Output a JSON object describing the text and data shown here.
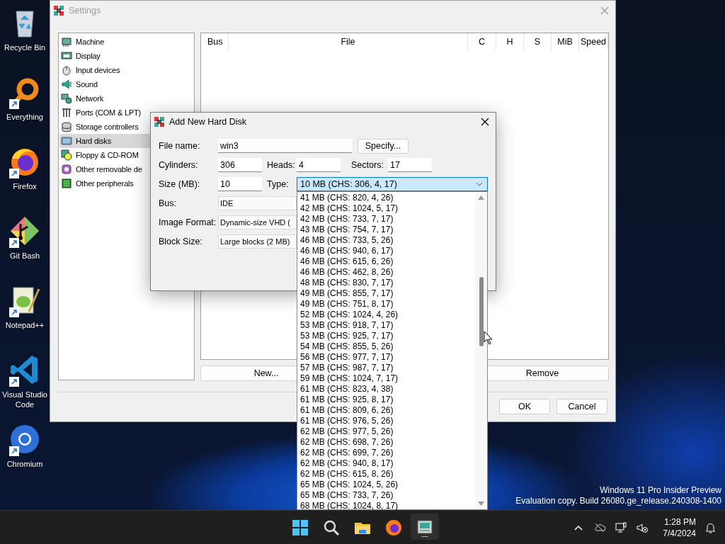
{
  "desktop_icons": [
    {
      "label": "Recycle Bin",
      "kind": "recycle",
      "shortcut": false
    },
    {
      "label": "Everything",
      "kind": "everything",
      "shortcut": true
    },
    {
      "label": "Firefox",
      "kind": "firefox",
      "shortcut": true
    },
    {
      "label": "Git Bash",
      "kind": "git",
      "shortcut": true
    },
    {
      "label": "Notepad++",
      "kind": "notepad",
      "shortcut": true
    },
    {
      "label": "Visual Studio Code",
      "kind": "vscode",
      "shortcut": true
    },
    {
      "label": "Chromium",
      "kind": "chromium",
      "shortcut": true
    }
  ],
  "settings": {
    "title": "Settings",
    "sidebar": [
      {
        "label": "Machine",
        "kind": "machine",
        "selected": false
      },
      {
        "label": "Display",
        "kind": "display",
        "selected": false
      },
      {
        "label": "Input devices",
        "kind": "input",
        "selected": false
      },
      {
        "label": "Sound",
        "kind": "sound",
        "selected": false
      },
      {
        "label": "Network",
        "kind": "network",
        "selected": false
      },
      {
        "label": "Ports (COM & LPT)",
        "kind": "ports",
        "selected": false
      },
      {
        "label": "Storage controllers",
        "kind": "storage",
        "selected": false
      },
      {
        "label": "Hard disks",
        "kind": "harddisk",
        "selected": true
      },
      {
        "label": "Floppy & CD-ROM",
        "kind": "floppy",
        "selected": false
      },
      {
        "label": "Other removable de",
        "kind": "removable",
        "selected": false
      },
      {
        "label": "Other peripherals",
        "kind": "peripherals",
        "selected": false
      }
    ],
    "table": {
      "columns": [
        "Bus",
        "File",
        "C",
        "H",
        "S",
        "MiB",
        "Speed"
      ]
    },
    "new_button": "New...",
    "remove_button": "Remove",
    "ok_button": "OK",
    "cancel_button": "Cancel"
  },
  "dialog": {
    "title": "Add New Hard Disk",
    "file_name": {
      "label": "File name:",
      "value": "win3"
    },
    "specify_button": "Specify...",
    "cylinders": {
      "label": "Cylinders:",
      "value": "306"
    },
    "heads": {
      "label": "Heads:",
      "value": "4"
    },
    "sectors": {
      "label": "Sectors:",
      "value": "17"
    },
    "size": {
      "label": "Size (MB):",
      "value": "10"
    },
    "type": {
      "label": "Type:",
      "value": "10 MB (CHS: 306, 4, 17)",
      "expanded": true,
      "options": [
        {
          "label": "41 MB (CHS: 820, 4, 26)",
          "selected": false
        },
        {
          "label": "42 MB (CHS: 1024, 5, 17)",
          "selected": false
        },
        {
          "label": "42 MB (CHS: 733, 7, 17)",
          "selected": false
        },
        {
          "label": "43 MB (CHS: 754, 7, 17)",
          "selected": false
        },
        {
          "label": "46 MB (CHS: 733, 5, 26)",
          "selected": false
        },
        {
          "label": "46 MB (CHS: 940, 6, 17)",
          "selected": false
        },
        {
          "label": "46 MB (CHS: 615, 6, 26)",
          "selected": false
        },
        {
          "label": "46 MB (CHS: 462, 8, 26)",
          "selected": false
        },
        {
          "label": "48 MB (CHS: 830, 7, 17)",
          "selected": false
        },
        {
          "label": "49 MB (CHS: 855, 7, 17)",
          "selected": false
        },
        {
          "label": "49 MB (CHS: 751, 8, 17)",
          "selected": false
        },
        {
          "label": "52 MB (CHS: 1024, 4, 26)",
          "selected": false
        },
        {
          "label": "53 MB (CHS: 918, 7, 17)",
          "selected": false
        },
        {
          "label": "53 MB (CHS: 925, 7, 17)",
          "selected": false
        },
        {
          "label": "54 MB (CHS: 855, 5, 26)",
          "selected": false
        },
        {
          "label": "56 MB (CHS: 977, 7, 17)",
          "selected": false
        },
        {
          "label": "57 MB (CHS: 987, 7, 17)",
          "selected": false
        },
        {
          "label": "59 MB (CHS: 1024, 7, 17)",
          "selected": false
        },
        {
          "label": "61 MB (CHS: 823, 4, 38)",
          "selected": false
        },
        {
          "label": "61 MB (CHS: 925, 8, 17)",
          "selected": false
        },
        {
          "label": "61 MB (CHS: 809, 6, 26)",
          "selected": false
        },
        {
          "label": "61 MB (CHS: 976, 5, 26)",
          "selected": false
        },
        {
          "label": "62 MB (CHS: 977, 5, 26)",
          "selected": false
        },
        {
          "label": "62 MB (CHS: 698, 7, 26)",
          "selected": false
        },
        {
          "label": "62 MB (CHS: 699, 7, 26)",
          "selected": false
        },
        {
          "label": "62 MB (CHS: 940, 8, 17)",
          "selected": false
        },
        {
          "label": "62 MB (CHS: 615, 8, 26)",
          "selected": false
        },
        {
          "label": "65 MB (CHS: 1024, 5, 26)",
          "selected": false
        },
        {
          "label": "65 MB (CHS: 733, 7, 26)",
          "selected": false
        },
        {
          "label": "68 MB (CHS: 1024, 8, 17)",
          "selected": false
        }
      ]
    },
    "bus": {
      "label": "Bus:",
      "value": "IDE"
    },
    "image_format": {
      "label": "Image Format:",
      "value": "Dynamic-size VHD ("
    },
    "block_size": {
      "label": "Block Size:",
      "value": "Large blocks (2 MB)"
    }
  },
  "os_notice": [
    "Windows 11 Pro Insider Preview",
    "Evaluation copy. Build 26080.ge_release.240308-1400"
  ],
  "taskbar": {
    "apps": [
      {
        "kind": "start",
        "active": false
      },
      {
        "kind": "search",
        "active": false
      },
      {
        "kind": "folder",
        "active": false
      },
      {
        "kind": "firefox",
        "active": false
      },
      {
        "kind": "emulator",
        "active": true
      }
    ],
    "tray": [
      {
        "kind": "chevron"
      },
      {
        "kind": "cloud-off"
      },
      {
        "kind": "network"
      },
      {
        "kind": "volume-muted"
      }
    ],
    "time": "1:28 PM",
    "date": "7/4/2024"
  }
}
